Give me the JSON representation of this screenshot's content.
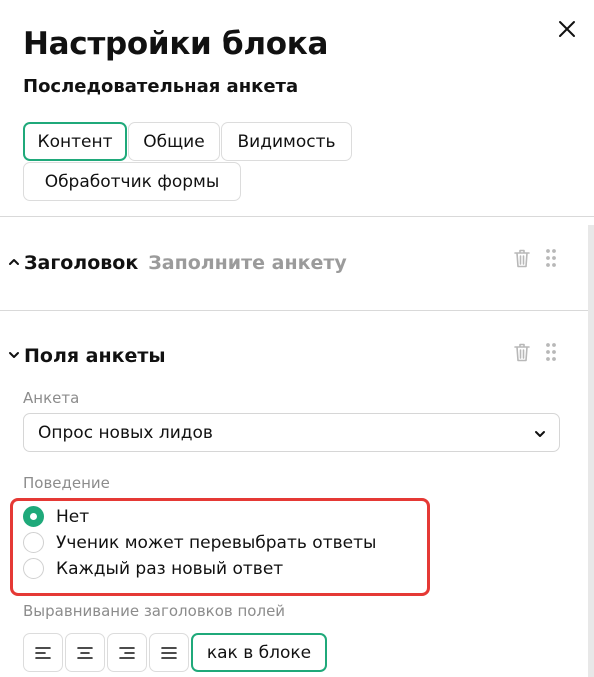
{
  "header": {
    "title": "Настройки блока",
    "subtitle": "Последовательная анкета"
  },
  "tabs": [
    {
      "label": "Контент",
      "active": true
    },
    {
      "label": "Общие",
      "active": false
    },
    {
      "label": "Видимость",
      "active": false
    },
    {
      "label": "Обработчик формы",
      "active": false
    }
  ],
  "sections": {
    "heading": {
      "title": "Заголовок",
      "value": "Заполните анкету",
      "expanded": false
    },
    "fields": {
      "title": "Поля анкеты",
      "expanded": true
    }
  },
  "form": {
    "survey_label": "Анкета",
    "survey_value": "Опрос новых лидов",
    "behavior_label": "Поведение",
    "behavior_options": [
      {
        "label": "Нет",
        "selected": true
      },
      {
        "label": "Ученик может перевыбрать ответы",
        "selected": false
      },
      {
        "label": "Каждый раз новый ответ",
        "selected": false
      }
    ],
    "alignment_label": "Выравнивание заголовков полей",
    "alignment_text_option": "как в блоке"
  },
  "colors": {
    "accent": "#1fa97a",
    "highlight": "#e53935",
    "muted": "#9b9b9b"
  },
  "icons": [
    "close-icon",
    "chevron-up-icon",
    "chevron-down-icon",
    "trash-icon",
    "drag-handle-icon",
    "align-left-icon",
    "align-center-icon",
    "align-right-icon",
    "align-justify-icon"
  ]
}
